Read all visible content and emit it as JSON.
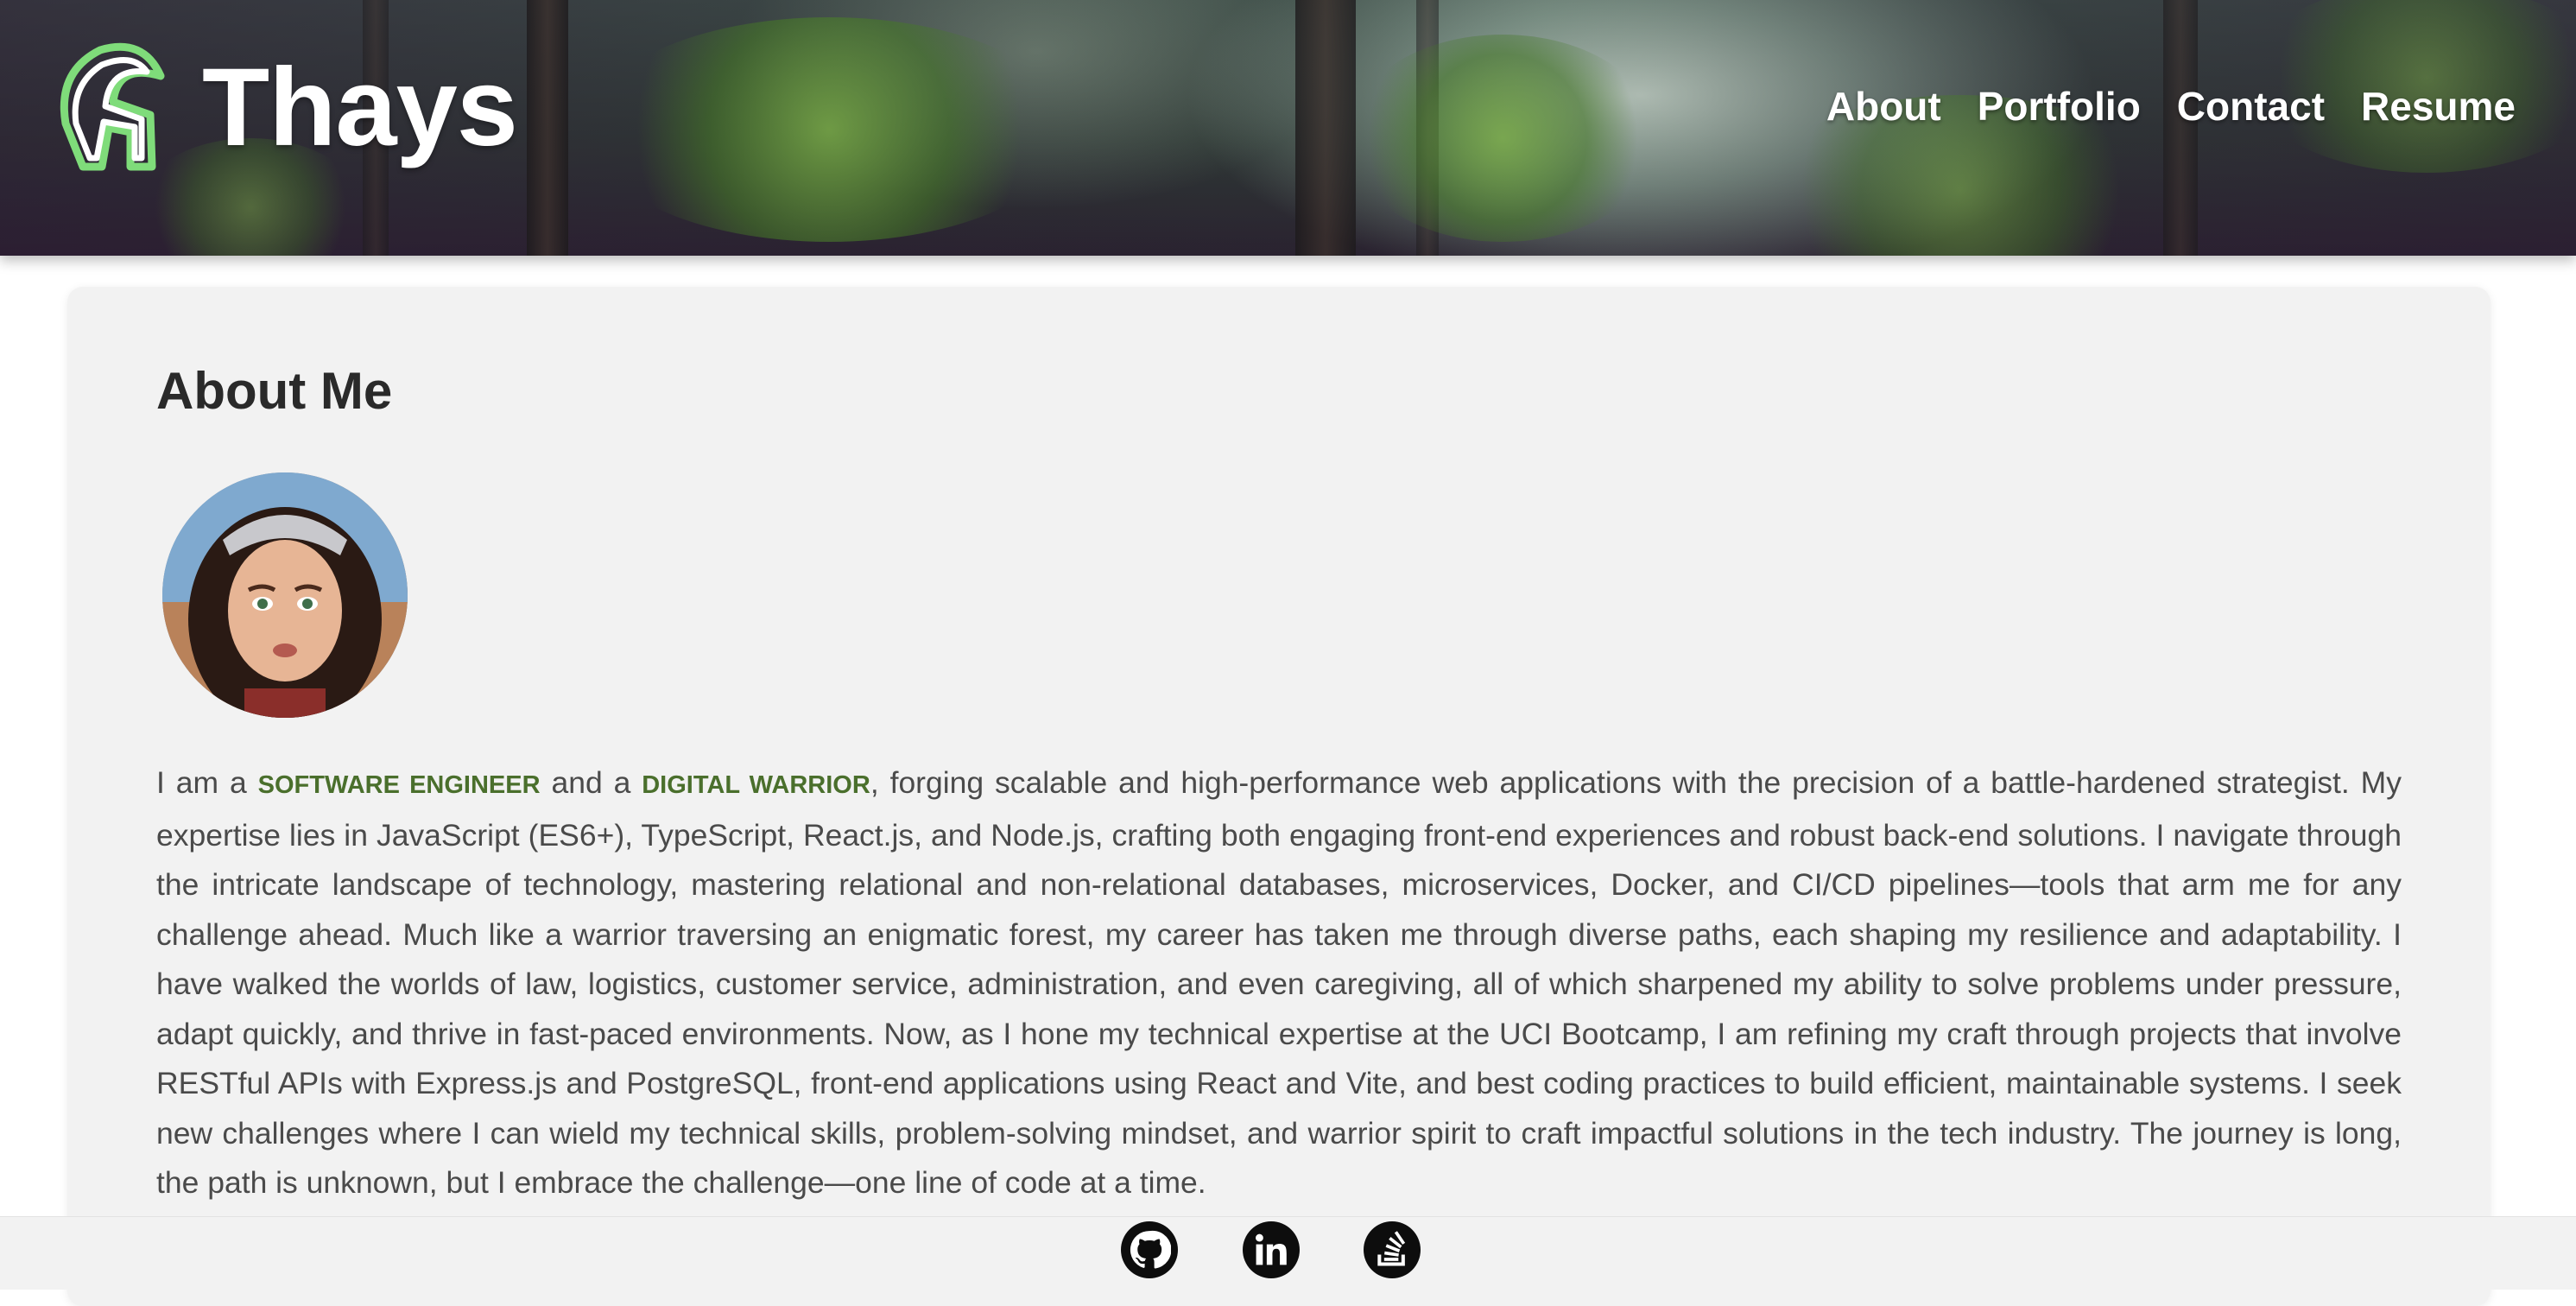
{
  "brand": {
    "name": "Thays",
    "logo_icon": "spartan-helmet-icon",
    "logo_color": "#7fdc7a"
  },
  "nav": {
    "items": [
      {
        "label": "About"
      },
      {
        "label": "Portfolio"
      },
      {
        "label": "Contact"
      },
      {
        "label": "Resume"
      }
    ]
  },
  "about": {
    "title": "About Me",
    "avatar_icon": "profile-avatar",
    "bio": {
      "intro": "I am a ",
      "highlight1": "SOFTWARE ENGINEER",
      "connector": " and a ",
      "highlight2": "DIGITAL WARRIOR",
      "rest": ", forging scalable and high-performance web applications with the precision of a battle-hardened strategist. My expertise lies in JavaScript (ES6+), TypeScript, React.js, and Node.js, crafting both engaging front-end experiences and robust back-end solutions. I navigate through the intricate landscape of technology, mastering relational and non-relational databases, microservices, Docker, and CI/CD pipelines—tools that arm me for any challenge ahead. Much like a warrior traversing an enigmatic forest, my career has taken me through diverse paths, each shaping my resilience and adaptability. I have walked the worlds of law, logistics, customer service, administration, and even caregiving, all of which sharpened my ability to solve problems under pressure, adapt quickly, and thrive in fast-paced environments. Now, as I hone my technical expertise at the UCI Bootcamp, I am refining my craft through projects that involve RESTful APIs with Express.js and PostgreSQL, front-end applications using React and Vite, and best coding practices to build efficient, maintainable systems. I seek new challenges where I can wield my technical skills, problem-solving mindset, and warrior spirit to craft impactful solutions in the tech industry. The journey is long, the path is unknown, but I embrace the challenge—one line of code at a time."
    },
    "highlight_color": "#4a6f2c"
  },
  "footer": {
    "social": [
      {
        "icon": "github-icon"
      },
      {
        "icon": "linkedin-icon"
      },
      {
        "icon": "stackoverflow-icon"
      }
    ]
  }
}
